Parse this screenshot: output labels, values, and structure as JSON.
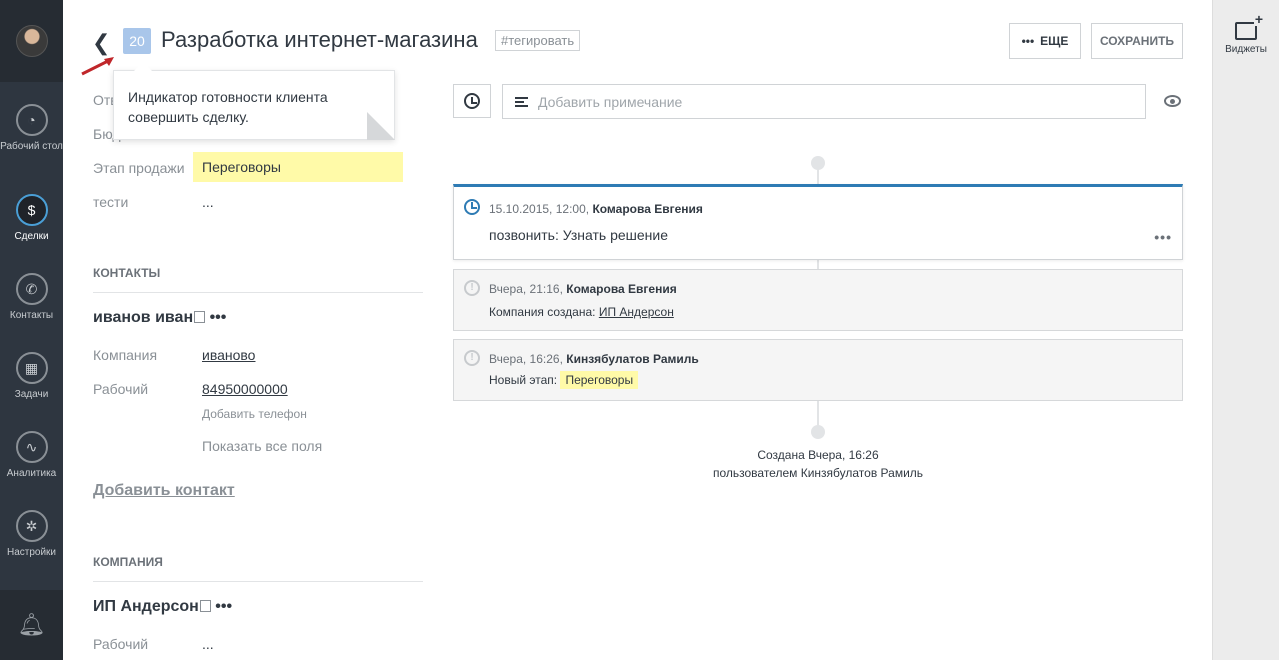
{
  "nav": {
    "items": [
      {
        "label": "Рабочий стол",
        "icon": "gauge-icon"
      },
      {
        "label": "Сделки",
        "icon": "dollar-icon"
      },
      {
        "label": "Контакты",
        "icon": "phone-icon"
      },
      {
        "label": "Задачи",
        "icon": "calendar-icon"
      },
      {
        "label": "Аналитика",
        "icon": "chart-icon"
      },
      {
        "label": "Настройки",
        "icon": "gear-icon"
      }
    ]
  },
  "widgets": {
    "label": "Виджеты"
  },
  "header": {
    "score": "20",
    "title": "Разработка интернет-магазина",
    "tag": "#тегировать",
    "more_label": "ЕЩЕ",
    "save_label": "СОХРАНИТЬ"
  },
  "tooltip": {
    "text": "Индикатор готовности клиента совершить сделку."
  },
  "fields": {
    "resp_label": "Отв",
    "budget_label": "Бюд",
    "stage_label": "Этап продажи",
    "stage_value": "Переговоры",
    "test_label": "тести",
    "test_value": "..."
  },
  "contacts": {
    "section_title": "КОНТАКТЫ",
    "name": "иванов иван",
    "company_label": "Компания",
    "company_value": "иваново",
    "work_label": "Рабочий",
    "work_value": "84950000000",
    "add_phone": "Добавить телефон",
    "show_all": "Показать все поля",
    "add_contact": "Добавить контакт"
  },
  "company": {
    "section_title": "КОМПАНИЯ",
    "name": "ИП Андерсон",
    "work_label": "Рабочий",
    "work_value": "..."
  },
  "feed": {
    "note_placeholder": "Добавить примечание",
    "task": {
      "date": "15.10.2015, 12:00,",
      "author": "Комарова Евгения",
      "text": "позвонить: Узнать решение"
    },
    "event1": {
      "date": "Вчера, 21:16,",
      "author": "Комарова Евгения",
      "text": "Компания создана:",
      "link": "ИП Андерсон"
    },
    "event2": {
      "date": "Вчера, 16:26,",
      "author": "Кинзябулатов Рамиль",
      "text": "Новый этап:",
      "stage": "Переговоры"
    },
    "created_line1": "Создана Вчера, 16:26",
    "created_line2": "пользователем Кинзябулатов Рамиль"
  },
  "colors": {
    "nav_bg": "#2e3640",
    "accent": "#2e7bb4",
    "highlight": "#fffaa8",
    "score_bg": "#a9c6ea",
    "arrow": "#c0262a"
  }
}
